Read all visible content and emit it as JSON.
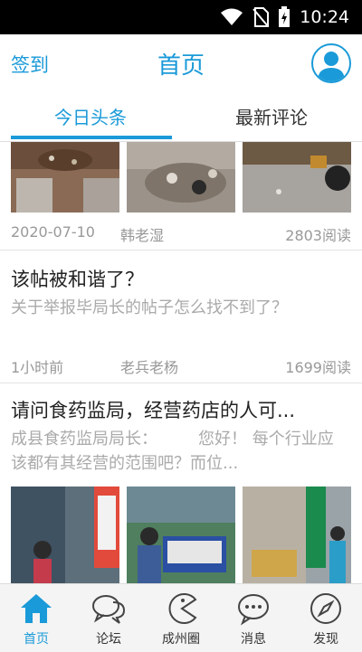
{
  "status_bar": {
    "time": "10:24"
  },
  "header": {
    "signin": "签到",
    "title": "首页"
  },
  "tabs": [
    {
      "label": "今日头条"
    },
    {
      "label": "最新评论"
    }
  ],
  "posts": [
    {
      "date": "2020-07-10",
      "author": "韩老湿",
      "reads": "2803阅读"
    },
    {
      "title": "该帖被和谐了？",
      "excerpt": "关于举报毕局长的帖子怎么找不到了？",
      "date": "1小时前",
      "author": "老兵老杨",
      "reads": "1699阅读"
    },
    {
      "title": "请问食药监局，经营药店的人可...",
      "excerpt": "成县食药监局局长：　　　您好！ 每个行业应该都有其经营的范围吧？而位..."
    }
  ],
  "tabbar": [
    {
      "label": "首页",
      "icon": "house-icon"
    },
    {
      "label": "论坛",
      "icon": "chat-bubbles-icon"
    },
    {
      "label": "成州圈",
      "icon": "pacman-face-icon"
    },
    {
      "label": "消息",
      "icon": "message-dots-icon"
    },
    {
      "label": "发现",
      "icon": "compass-icon"
    }
  ],
  "colors": {
    "accent": "#1a9ad8",
    "statusbar": "#000000"
  }
}
